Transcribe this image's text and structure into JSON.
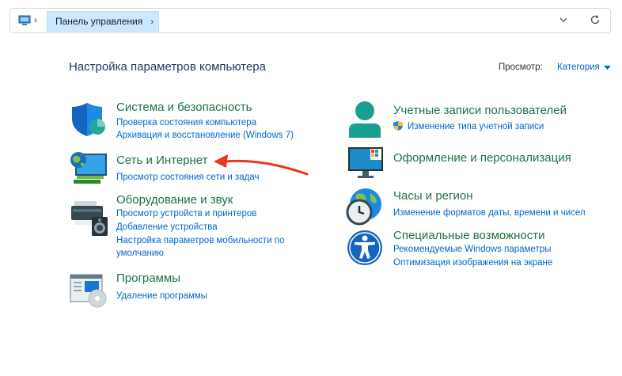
{
  "address_bar": {
    "breadcrumb": "Панель управления"
  },
  "heading": "Настройка параметров компьютера",
  "view": {
    "label": "Просмотр:",
    "value": "Категория"
  },
  "categories": {
    "system": {
      "title": "Система и безопасность",
      "links": [
        "Проверка состояния компьютера",
        "Архивация и восстановление (Windows 7)"
      ]
    },
    "network": {
      "title": "Сеть и Интернет",
      "links": [
        "Просмотр состояния сети и задач"
      ]
    },
    "hardware": {
      "title": "Оборудование и звук",
      "links": [
        "Просмотр устройств и принтеров",
        "Добавление устройства",
        "Настройка параметров мобильности по",
        "умолчанию"
      ]
    },
    "programs": {
      "title": "Программы",
      "links": [
        "Удаление программы"
      ]
    },
    "accounts": {
      "title": "Учетные записи пользователей",
      "links": [
        "Изменение типа учетной записи"
      ]
    },
    "appearance": {
      "title": "Оформление и персонализация",
      "links": []
    },
    "clock": {
      "title": "Часы и регион",
      "links": [
        "Изменение форматов даты, времени и чисел"
      ]
    },
    "access": {
      "title": "Специальные возможности",
      "links": [
        "Рекомендуемые Windows параметры",
        "Оптимизация изображения на экране"
      ]
    }
  },
  "colors": {
    "title_green": "#1e7145",
    "link_blue": "#0066cc",
    "heading_navy": "#1e395b",
    "arrow_red": "#e5391f"
  }
}
